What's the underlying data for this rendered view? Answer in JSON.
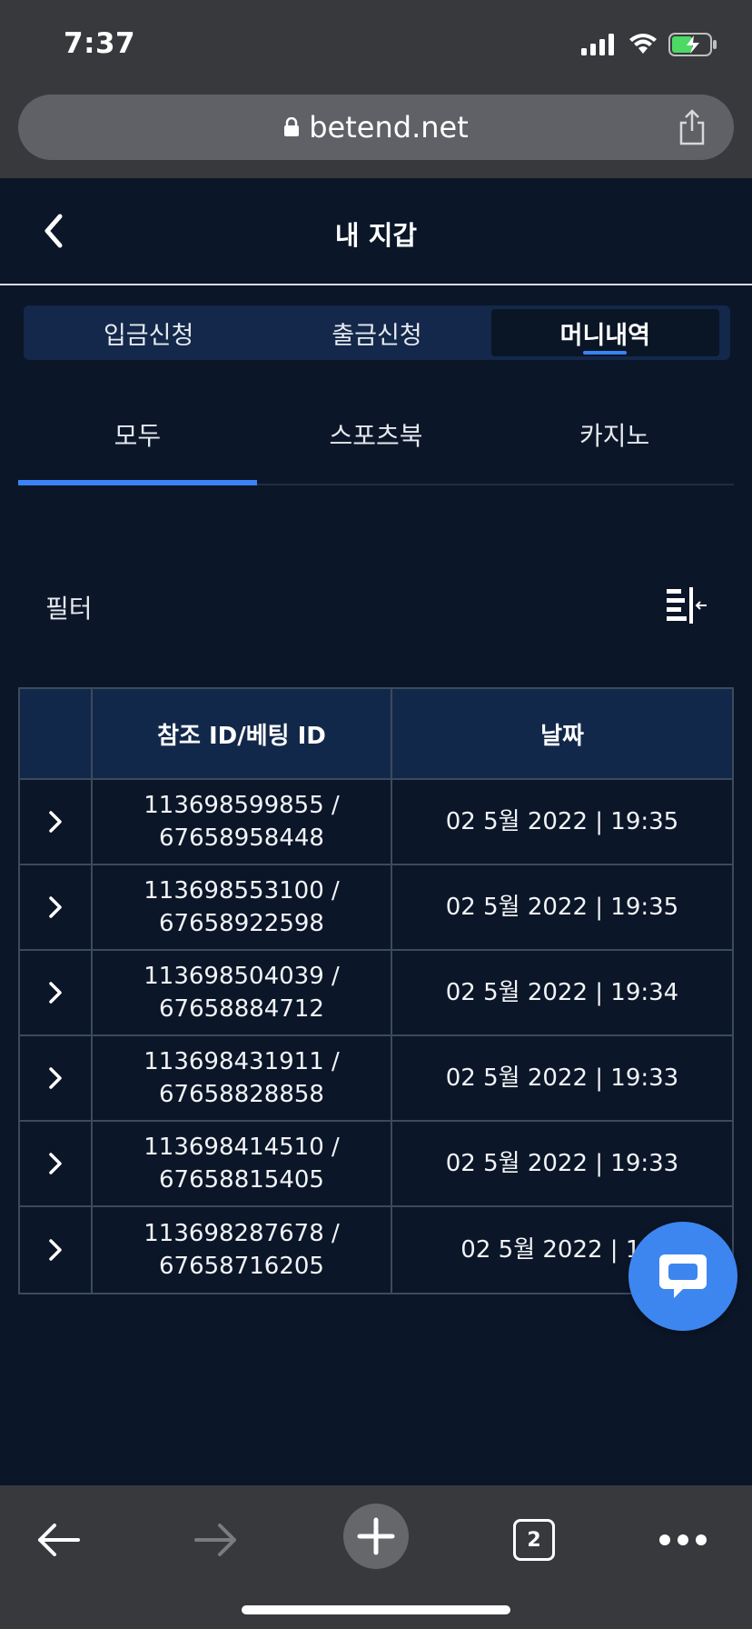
{
  "status_bar": {
    "time": "7:37"
  },
  "browser": {
    "url": "betend.net",
    "tab_count": "2"
  },
  "header": {
    "title": "내 지갑"
  },
  "segment_tabs": [
    {
      "label": "입금신청",
      "active": false
    },
    {
      "label": "출금신청",
      "active": false
    },
    {
      "label": "머니내역",
      "active": true
    }
  ],
  "category_tabs": [
    {
      "label": "모두",
      "active": true
    },
    {
      "label": "스포츠북",
      "active": false
    },
    {
      "label": "카지노",
      "active": false
    }
  ],
  "filter": {
    "label": "필터"
  },
  "table": {
    "headers": {
      "ref": "참조 ID/베팅 ID",
      "date": "날짜"
    },
    "rows": [
      {
        "ref_id": "113698599855 /",
        "bet_id": "67658958448",
        "date": "02 5월 2022 | 19:35"
      },
      {
        "ref_id": "113698553100 /",
        "bet_id": "67658922598",
        "date": "02 5월 2022 | 19:35"
      },
      {
        "ref_id": "113698504039 /",
        "bet_id": "67658884712",
        "date": "02 5월 2022 | 19:34"
      },
      {
        "ref_id": "113698431911 /",
        "bet_id": "67658828858",
        "date": "02 5월 2022 | 19:33"
      },
      {
        "ref_id": "113698414510 /",
        "bet_id": "67658815405",
        "date": "02 5월 2022 | 19:33"
      },
      {
        "ref_id": "113698287678 /",
        "bet_id": "67658716205",
        "date": "02 5월 2022 | 19:"
      }
    ]
  },
  "colors": {
    "background": "#0b1628",
    "accent": "#3b82f6",
    "header_bg": "#12284a",
    "chat": "#3d86f0"
  }
}
